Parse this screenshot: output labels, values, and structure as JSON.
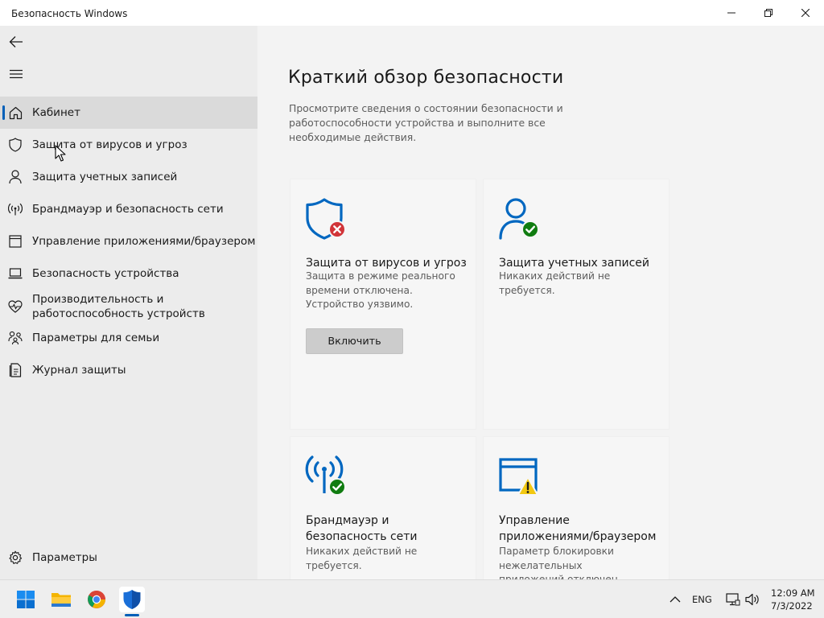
{
  "window": {
    "title": "Безопасность Windows"
  },
  "sidebar": {
    "back_icon": "back-arrow-icon",
    "menu_icon": "hamburger-icon",
    "items": [
      {
        "label": "Кабинет",
        "icon": "home-icon",
        "active": true
      },
      {
        "label": "Защита от вирусов и угроз",
        "icon": "shield-icon"
      },
      {
        "label": "Защита учетных записей",
        "icon": "person-icon"
      },
      {
        "label": "Брандмауэр и безопасность сети",
        "icon": "antenna-icon"
      },
      {
        "label": "Управление приложениями/браузером",
        "icon": "app-window-icon"
      },
      {
        "label": "Безопасность устройства",
        "icon": "laptop-icon"
      },
      {
        "label_line1": "Производительность и",
        "label_line2": "работоспособность устройств",
        "icon": "heart-pulse-icon"
      },
      {
        "label": "Параметры для семьи",
        "icon": "family-icon"
      },
      {
        "label": "Журнал защиты",
        "icon": "history-icon"
      }
    ],
    "settings_label": "Параметры",
    "accent_color": "#005fb8"
  },
  "main": {
    "title": "Краткий обзор безопасности",
    "description": "Просмотрите сведения о состоянии безопасности и работоспособности устройства и выполните все необходимые действия.",
    "cards": [
      {
        "title": "Защита от вирусов и угроз",
        "description": "Защита в режиме реального времени отключена. Устройство уязвимо.",
        "button": "Включить",
        "icon": "shield-error-icon",
        "status": "error"
      },
      {
        "title": "Защита учетных записей",
        "description": "Никаких действий не требуется.",
        "icon": "person-ok-icon",
        "status": "ok"
      },
      {
        "title": "Брандмауэр и безопасность сети",
        "description": "Никаких действий не требуется.",
        "icon": "antenna-ok-icon",
        "status": "ok"
      },
      {
        "title": "Управление приложениями/браузером",
        "description": "Параметр блокировки нежелательных приложений отключен. Устройство может",
        "icon": "app-window-warning-icon",
        "status": "warning"
      }
    ],
    "status_colors": {
      "ok": "#107c10",
      "error": "#d13438",
      "warning": "#f2c811",
      "icon_blue": "#0067c0"
    }
  },
  "taskbar": {
    "apps": [
      "windows-start-icon",
      "file-explorer-icon",
      "chrome-icon",
      "windows-security-icon"
    ],
    "language": "ENG",
    "time": "12:09 AM",
    "date": "7/3/2022"
  }
}
